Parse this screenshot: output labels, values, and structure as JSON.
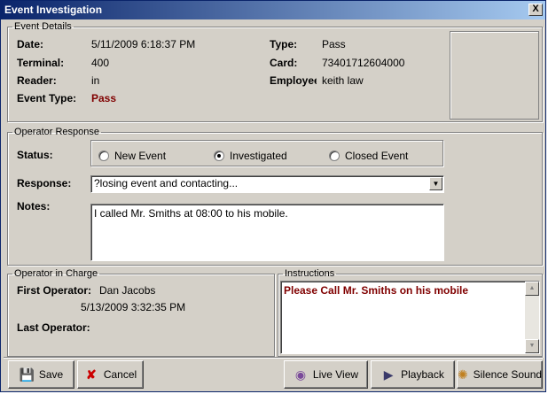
{
  "window": {
    "title": "Event Investigation",
    "close_glyph": "X"
  },
  "event_details": {
    "legend": "Event Details",
    "date_label": "Date:",
    "date_value": "5/11/2009 6:18:37 PM",
    "terminal_label": "Terminal:",
    "terminal_value": "400",
    "reader_label": "Reader:",
    "reader_value": "in",
    "event_type_label": "Event Type:",
    "event_type_value": "Pass",
    "type_label": "Type:",
    "type_value": "Pass",
    "card_label": "Card:",
    "card_value": "73401712604000",
    "employee_label": "Employee",
    "employee_value": "keith law"
  },
  "operator_response": {
    "legend": "Operator Response",
    "status_label": "Status:",
    "status_options": [
      "New Event",
      "Investigated",
      "Closed Event"
    ],
    "status_selected": "Investigated",
    "response_label": "Response:",
    "response_value": "?losing event and contacting...",
    "notes_label": "Notes:",
    "notes_value": "I called Mr. Smiths at 08:00 to his mobile."
  },
  "operator_in_charge": {
    "legend": "Operator in Charge",
    "first_label": "First Operator:",
    "first_value": "Dan Jacobs",
    "first_time": "5/13/2009 3:32:35 PM",
    "last_label": "Last Operator:",
    "last_value": ""
  },
  "instructions": {
    "legend": "Instructions",
    "text": "Please Call Mr. Smiths on his mobile"
  },
  "buttons": {
    "save": "Save",
    "cancel": "Cancel",
    "live_view": "Live View",
    "playback": "Playback",
    "silence_sound": "Silence Sound"
  },
  "colors": {
    "accent_red": "#800000",
    "title_bar": "#0a246a"
  },
  "icons": [
    "close-icon",
    "save-icon",
    "cancel-icon",
    "live-view-icon",
    "playback-icon",
    "silence-sound-icon",
    "radio-icon",
    "dropdown-arrow-icon",
    "scroll-up-icon",
    "scroll-down-icon"
  ]
}
